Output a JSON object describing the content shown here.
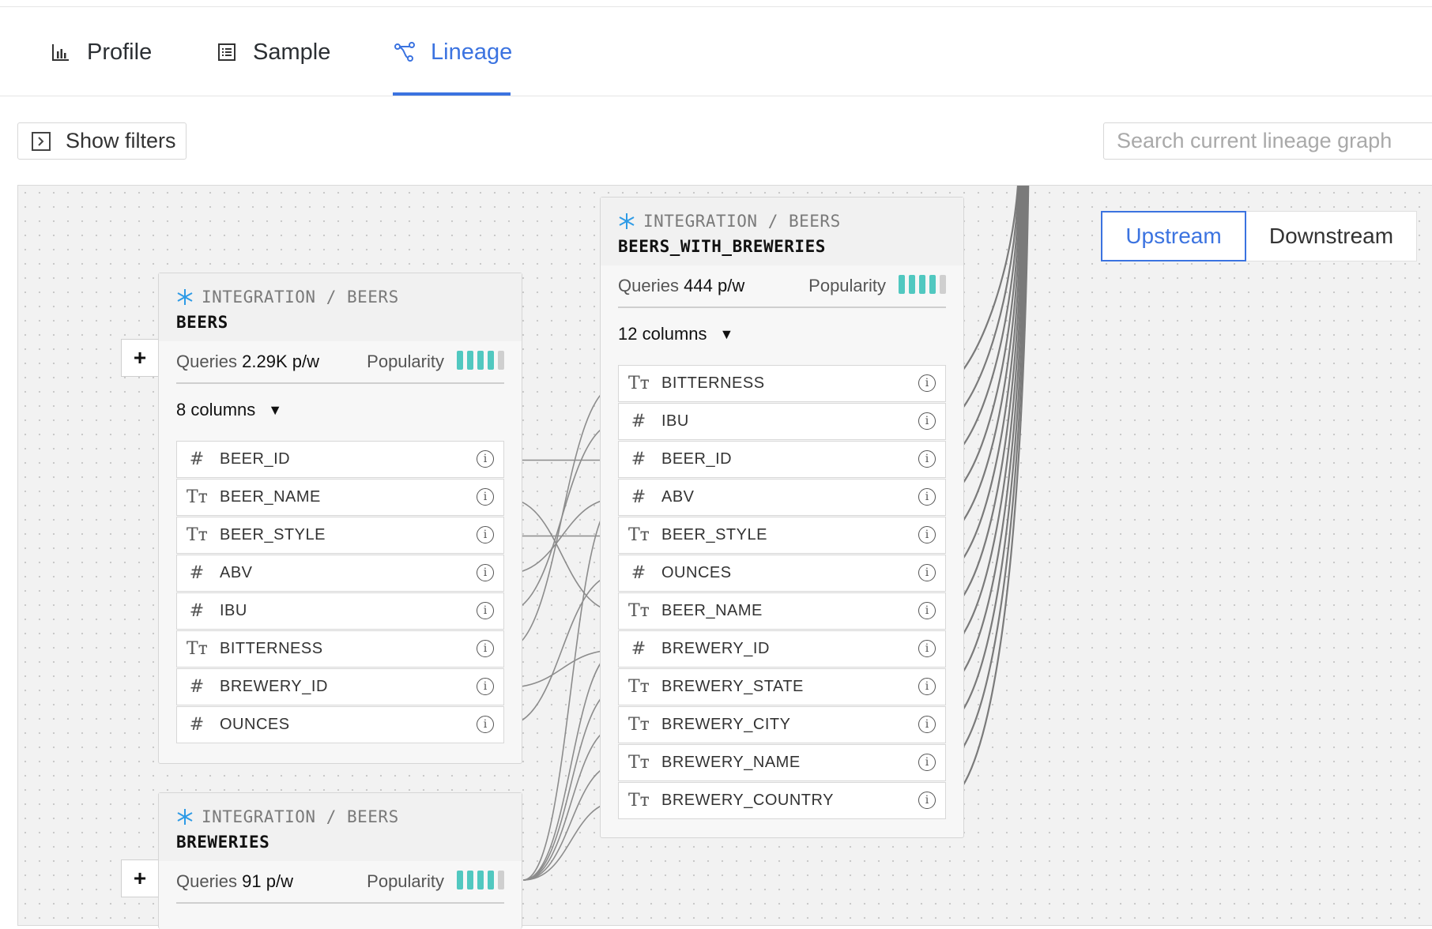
{
  "tabs": [
    {
      "label": "Profile",
      "icon": "bar-chart-icon"
    },
    {
      "label": "Sample",
      "icon": "list-icon"
    },
    {
      "label": "Lineage",
      "icon": "lineage-icon",
      "active": true
    }
  ],
  "toolbar": {
    "show_filters_label": "Show filters",
    "search_placeholder": "Search current lineage graph"
  },
  "direction_toggle": {
    "upstream_label": "Upstream",
    "downstream_label": "Downstream",
    "selected": "Upstream"
  },
  "colors": {
    "accent": "#3b73e0",
    "popularity_bar": "#51c8c0",
    "snowflake": "#2e9be6"
  },
  "nodes": {
    "beers": {
      "path": "INTEGRATION / BEERS",
      "name": "BEERS",
      "queries_label": "Queries",
      "queries_value": "2.29K p/w",
      "popularity_label": "Popularity",
      "popularity_level": 4,
      "popularity_max": 5,
      "columns_label": "8 columns",
      "columns": [
        {
          "type": "#",
          "name": "BEER_ID"
        },
        {
          "type": "Tт",
          "name": "BEER_NAME"
        },
        {
          "type": "Tт",
          "name": "BEER_STYLE"
        },
        {
          "type": "#",
          "name": "ABV"
        },
        {
          "type": "#",
          "name": "IBU"
        },
        {
          "type": "Tт",
          "name": "BITTERNESS"
        },
        {
          "type": "#",
          "name": "BREWERY_ID"
        },
        {
          "type": "#",
          "name": "OUNCES"
        }
      ]
    },
    "breweries": {
      "path": "INTEGRATION / BEERS",
      "name": "BREWERIES",
      "queries_label": "Queries",
      "queries_value": "91 p/w",
      "popularity_label": "Popularity",
      "popularity_level": 4,
      "popularity_max": 5
    },
    "beers_with_breweries": {
      "path": "INTEGRATION / BEERS",
      "name": "BEERS_WITH_BREWERIES",
      "queries_label": "Queries",
      "queries_value": "444 p/w",
      "popularity_label": "Popularity",
      "popularity_level": 4,
      "popularity_max": 5,
      "columns_label": "12 columns",
      "columns": [
        {
          "type": "Tт",
          "name": "BITTERNESS"
        },
        {
          "type": "#",
          "name": "IBU"
        },
        {
          "type": "#",
          "name": "BEER_ID"
        },
        {
          "type": "#",
          "name": "ABV"
        },
        {
          "type": "Tт",
          "name": "BEER_STYLE"
        },
        {
          "type": "#",
          "name": "OUNCES"
        },
        {
          "type": "Tт",
          "name": "BEER_NAME"
        },
        {
          "type": "#",
          "name": "BREWERY_ID"
        },
        {
          "type": "Tт",
          "name": "BREWERY_STATE"
        },
        {
          "type": "Tт",
          "name": "BREWERY_CITY"
        },
        {
          "type": "Tт",
          "name": "BREWERY_NAME"
        },
        {
          "type": "Tт",
          "name": "BREWERY_COUNTRY"
        }
      ]
    }
  },
  "expand_buttons": {
    "label": "+"
  }
}
